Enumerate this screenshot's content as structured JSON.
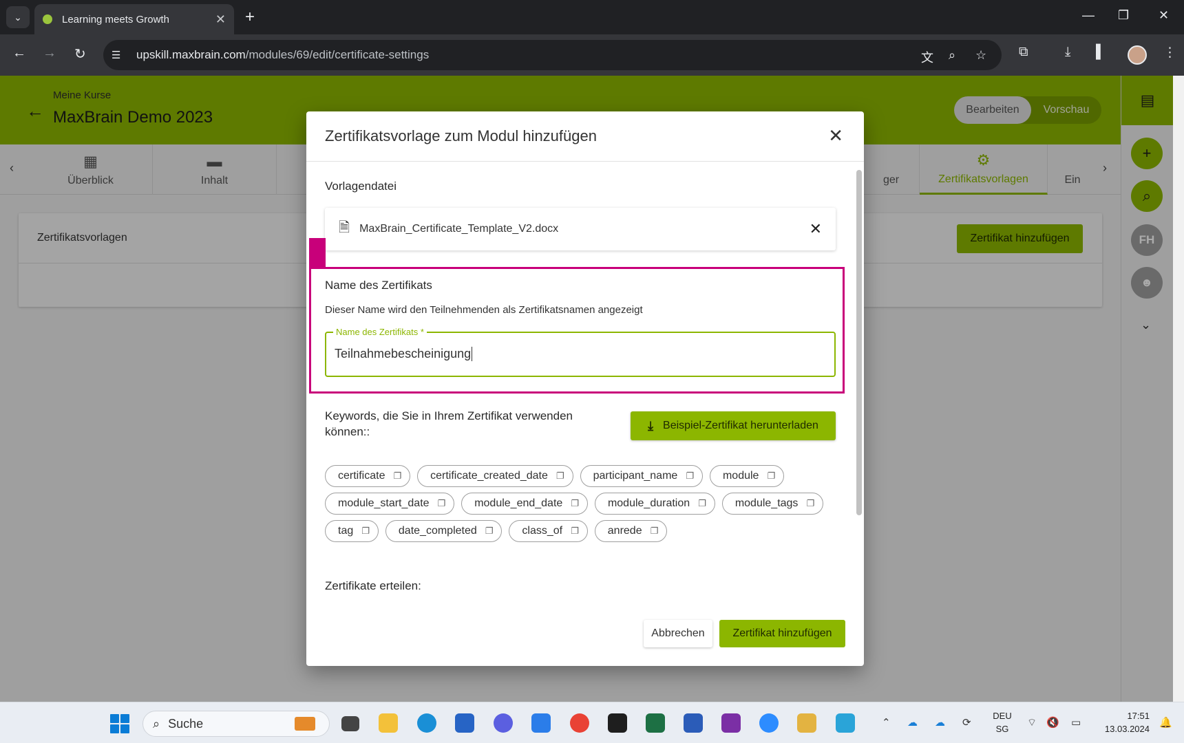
{
  "browser": {
    "tab_title": "Learning meets Growth",
    "url_host": "upskill.maxbrain.com",
    "url_path": "/modules/69/edit/certificate-settings"
  },
  "header": {
    "breadcrumb": "Meine Kurse",
    "course_title": "MaxBrain Demo 2023",
    "mode_edit": "Bearbeiten",
    "mode_preview": "Vorschau"
  },
  "tabs": [
    {
      "label": "Überblick",
      "icon": "dashboard-icon"
    },
    {
      "label": "Inhalt",
      "icon": "folder-icon"
    },
    {
      "label": "ger",
      "icon": "partial-tab-icon"
    },
    {
      "label": "Zertifikatsvorlagen",
      "icon": "certificate-settings-icon",
      "active": true
    },
    {
      "label": "Ein",
      "icon": "partial-tab-icon"
    }
  ],
  "card": {
    "title": "Zertifikatsvorlagen",
    "add_button": "Zertifikat hinzufügen"
  },
  "side_rail": {
    "avatar_initials": "FH"
  },
  "modal": {
    "title": "Zertifikatsvorlage zum Modul hinzufügen",
    "template_file_label": "Vorlagendatei",
    "file_name": "MaxBrain_Certificate_Template_V2.docx",
    "name_section_title": "Name des Zertifikats",
    "name_description": "Dieser Name wird den Teilnehmenden als Zertifikatsnamen angezeigt",
    "name_field_label": "Name des Zertifikats *",
    "name_field_value": "Teilnahmebescheinigung",
    "keywords_label": "Keywords, die Sie in Ihrem Zertifikat verwenden können::",
    "download_button": "Beispiel-Zertifikat herunterladen",
    "keywords": [
      [
        "certificate",
        "certificate_created_date",
        "participant_name",
        "module"
      ],
      [
        "module_start_date",
        "module_end_date",
        "module_duration",
        "module_tags"
      ],
      [
        "tag",
        "date_completed",
        "class_of",
        "anrede"
      ]
    ],
    "issue_label": "Zertifikate erteilen:",
    "cancel_button": "Abbrechen",
    "submit_button": "Zertifikat hinzufügen"
  },
  "taskbar": {
    "search_placeholder": "Suche",
    "lang_top": "DEU",
    "lang_bottom": "SG",
    "time": "17:51",
    "date": "13.03.2024"
  },
  "colors": {
    "brand_green": "#8cb600",
    "highlight_magenta": "#c8007a"
  }
}
